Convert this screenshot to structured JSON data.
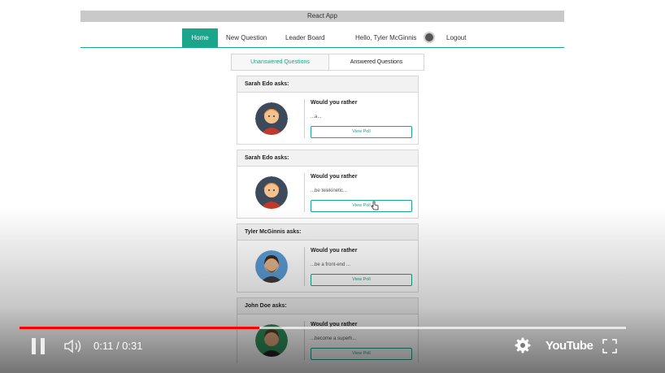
{
  "app": {
    "window_title": "React App"
  },
  "nav": {
    "home": "Home",
    "new_question": "New Question",
    "leader_board": "Leader Board",
    "greeting": "Hello, Tyler McGinnis",
    "logout": "Logout"
  },
  "tabs": {
    "unanswered": "Unanswered Questions",
    "answered": "Answered Questions",
    "active": "unanswered"
  },
  "questions": [
    {
      "author_line": "Sarah Edo asks:",
      "prompt": "Would you rather",
      "snippet": "...a...",
      "button": "View Poll",
      "avatar": "sarah-avatar-icon"
    },
    {
      "author_line": "Sarah Edo asks:",
      "prompt": "Would you rather",
      "snippet": "...be telekinetic...",
      "button": "View Poll",
      "avatar": "sarah-avatar-icon"
    },
    {
      "author_line": "Tyler McGinnis asks:",
      "prompt": "Would you rather",
      "snippet": "...be a front-end ...",
      "button": "View Poll",
      "avatar": "tyler-avatar-icon"
    },
    {
      "author_line": "John Doe asks:",
      "prompt": "Would you rather",
      "snippet": "...become a superh...",
      "button": "View Poll",
      "avatar": "john-avatar-icon"
    }
  ],
  "player": {
    "time_display": "0:11 / 0:31",
    "played_fraction": 0.395,
    "loaded_fraction": 1.0,
    "logo": "YouTube",
    "accent_color": "#ff0000"
  },
  "colors": {
    "brand": "#19a68a"
  }
}
